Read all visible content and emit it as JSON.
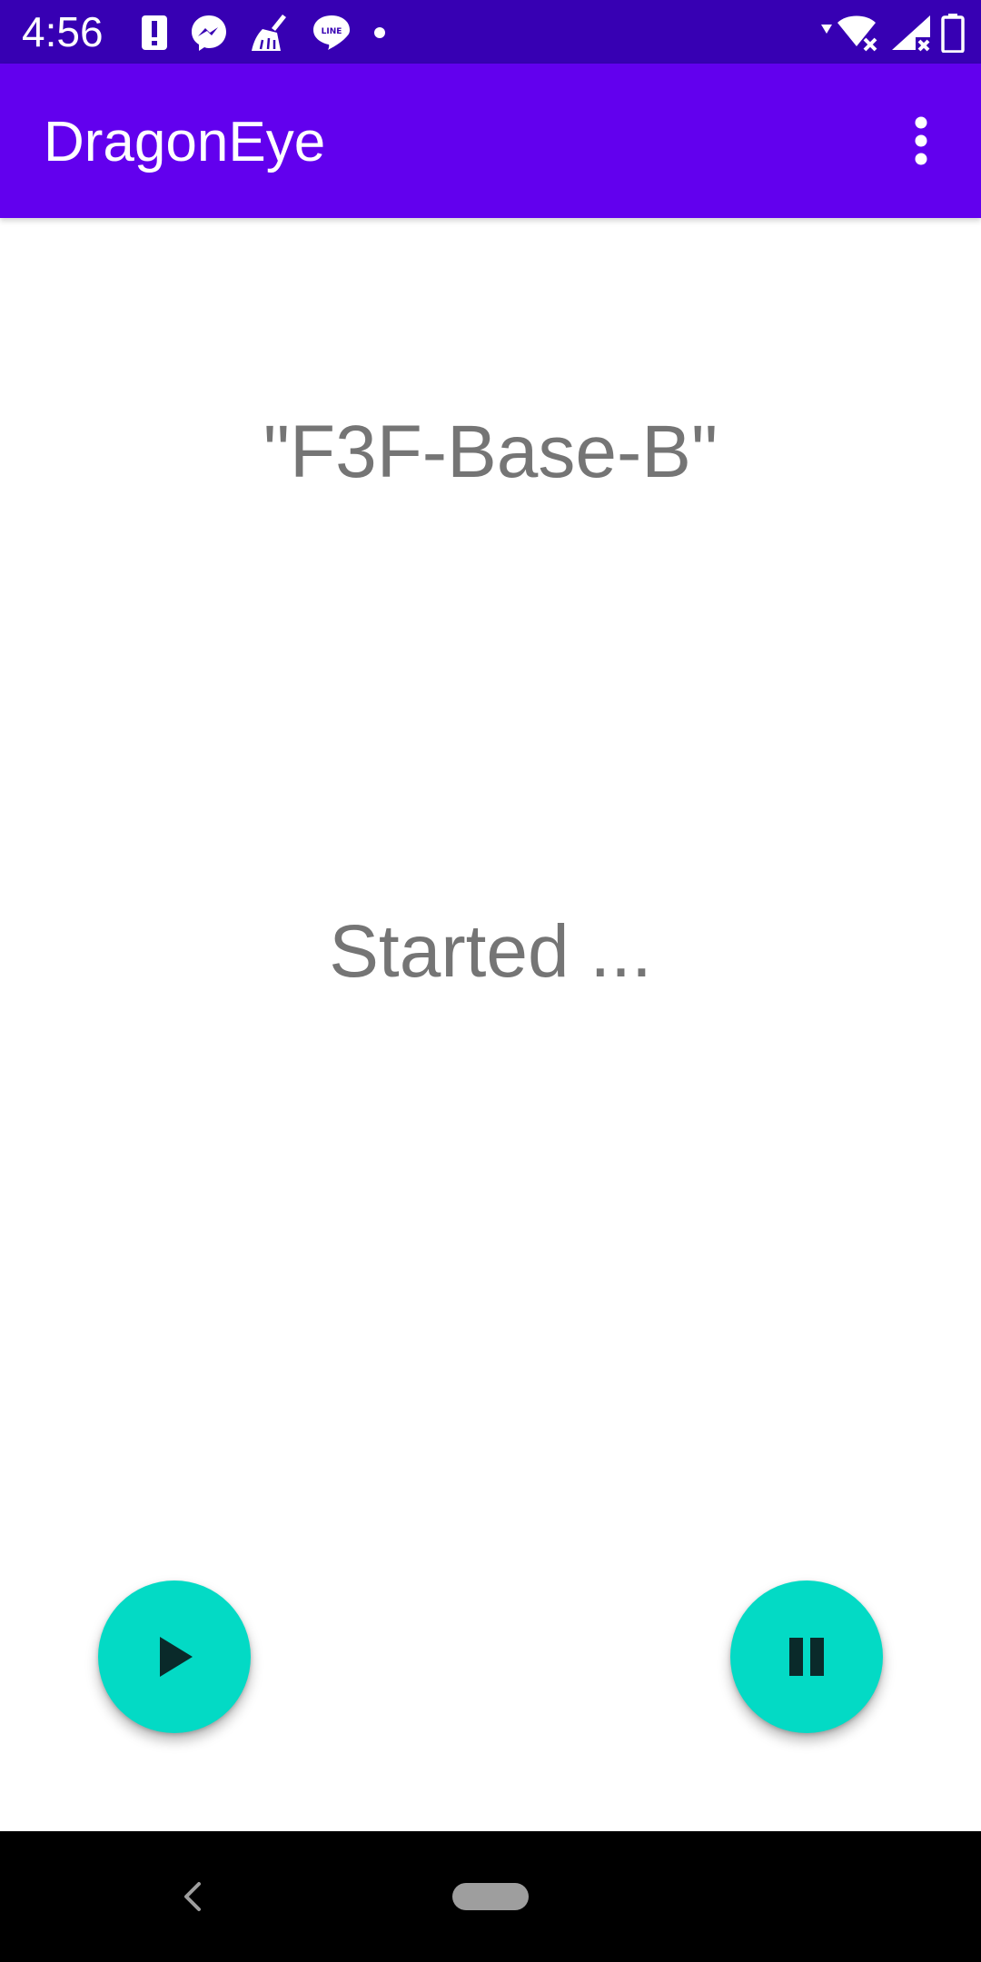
{
  "status_bar": {
    "time": "4:56",
    "background_color": "#3700b3",
    "left_icons": [
      "alert-icon",
      "messenger-icon",
      "broom-icon",
      "line-icon",
      "dot-icon"
    ],
    "right_icons": [
      "wifi-off-icon",
      "signal-off-icon",
      "battery-icon"
    ]
  },
  "app_bar": {
    "title": "DragonEye",
    "background_color": "#6200ee",
    "menu_icon": "more-vert-icon"
  },
  "main": {
    "device_name": "\"F3F-Base-B\"",
    "status_message": "Started ..."
  },
  "fabs": {
    "accent_color": "#03dac5",
    "play_icon": "play-icon",
    "pause_icon": "pause-icon"
  },
  "nav_bar": {
    "back_icon": "back-chevron-icon",
    "home_icon": "home-pill-icon"
  }
}
